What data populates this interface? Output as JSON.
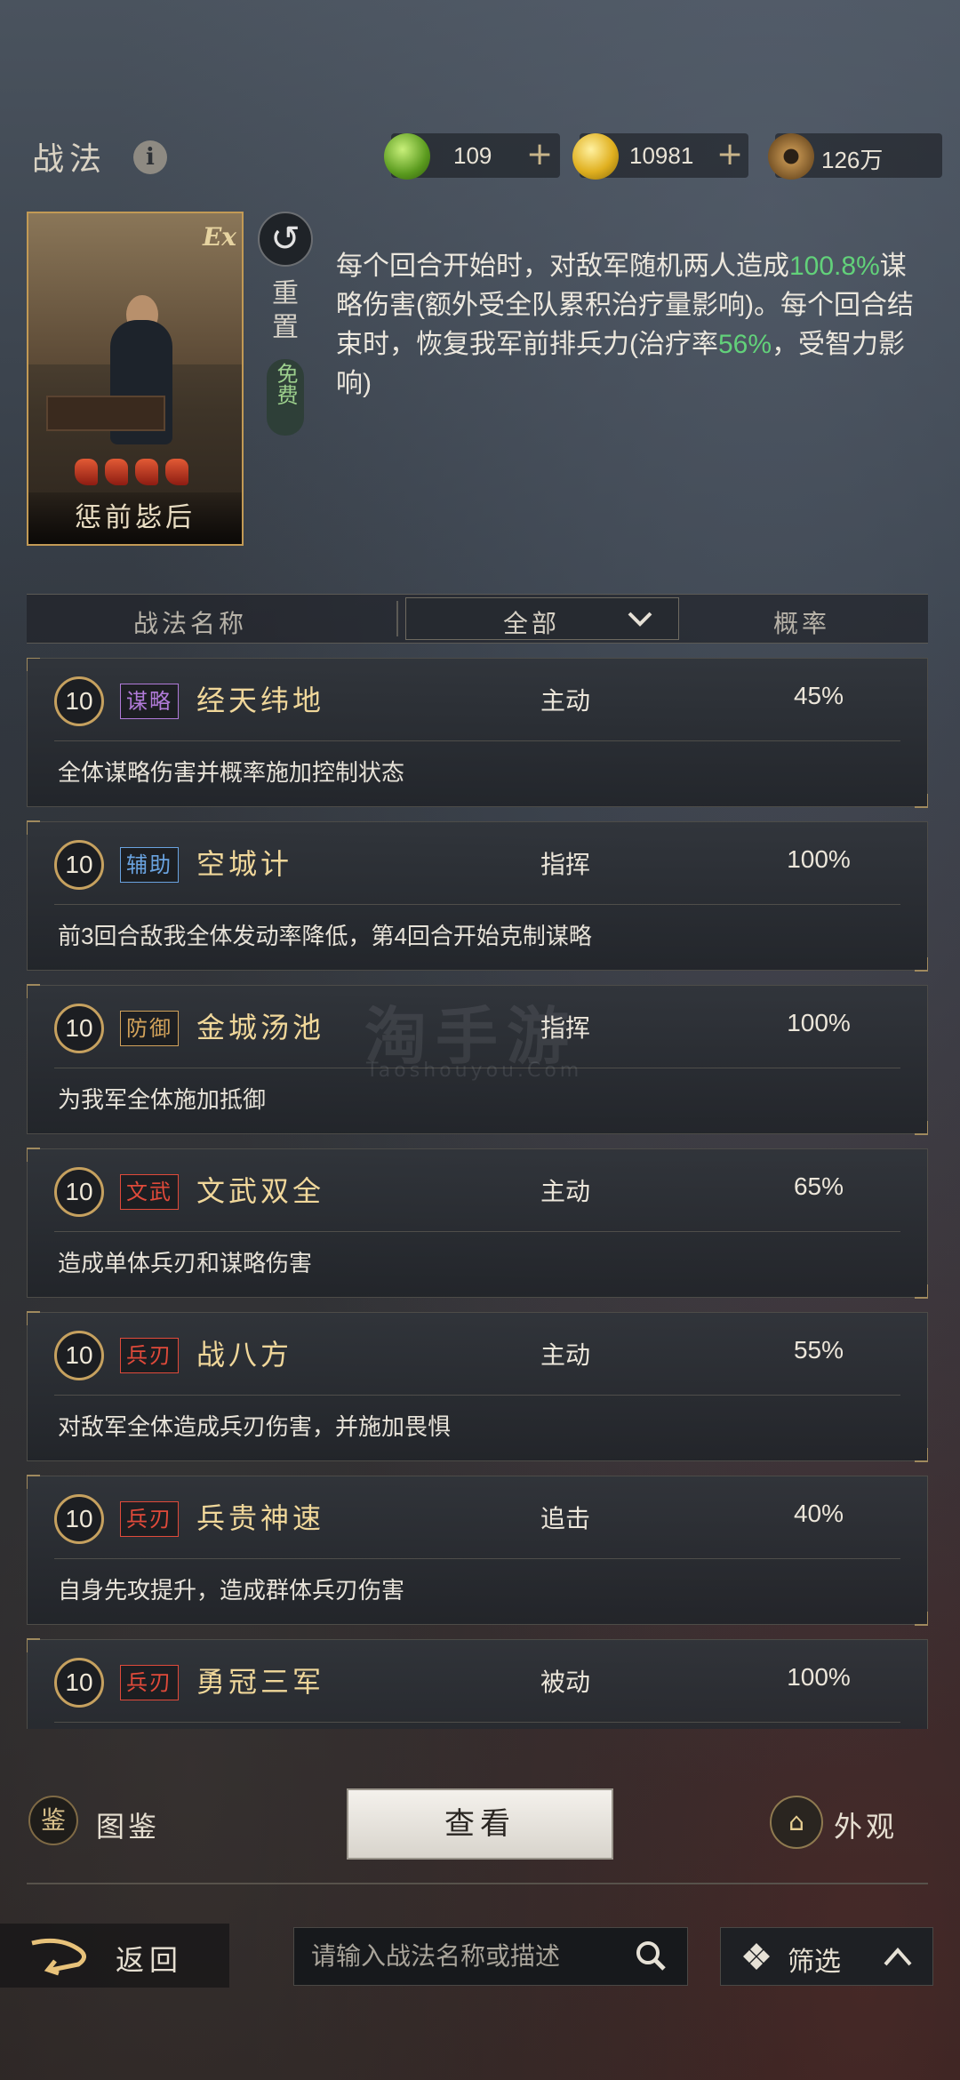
{
  "header": {
    "title": "战法",
    "currencies": [
      {
        "name": "jade",
        "value": "109",
        "color": "#7fbf3a"
      },
      {
        "name": "gold",
        "value": "10981",
        "color": "#e5b620"
      },
      {
        "name": "copper",
        "value": "126万",
        "color": "#a0703a"
      }
    ]
  },
  "hero": {
    "name": "惩前毖后",
    "rank_marks": 4,
    "reset_label": "重置",
    "free_label": "免费"
  },
  "description": {
    "p1": "每个回合开始时，对敌军随机两人造成",
    "v1": "100.8%",
    "p2": "谋略伤害(额外受全队累积治疗量影响)。每个回合结束时，恢复我军前排兵力(治疗率",
    "v2": "56%",
    "p3": "，受智力影响)"
  },
  "table_header": {
    "name_col": "战法名称",
    "filter_value": "全部",
    "rate_col": "概率"
  },
  "skills": [
    {
      "level": "10",
      "tag": "谋略",
      "tag_color": "#b07ad8",
      "name": "经天纬地",
      "type": "主动",
      "rate": "45%",
      "desc": "全体谋略伤害并概率施加控制状态"
    },
    {
      "level": "10",
      "tag": "辅助",
      "tag_color": "#6aa3e0",
      "name": "空城计",
      "type": "指挥",
      "rate": "100%",
      "desc": "前3回合敌我全体发动率降低，第4回合开始克制谋略"
    },
    {
      "level": "10",
      "tag": "防御",
      "tag_color": "#d2a25a",
      "name": "金城汤池",
      "type": "指挥",
      "rate": "100%",
      "desc": "为我军全体施加抵御"
    },
    {
      "level": "10",
      "tag": "文武",
      "tag_color": "#e04a3a",
      "name": "文武双全",
      "type": "主动",
      "rate": "65%",
      "desc": "造成单体兵刃和谋略伤害"
    },
    {
      "level": "10",
      "tag": "兵刃",
      "tag_color": "#e04a3a",
      "name": "战八方",
      "type": "主动",
      "rate": "55%",
      "desc": "对敌军全体造成兵刃伤害，并施加畏惧"
    },
    {
      "level": "10",
      "tag": "兵刃",
      "tag_color": "#e04a3a",
      "name": "兵贵神速",
      "type": "追击",
      "rate": "40%",
      "desc": "自身先攻提升，造成群体兵刃伤害"
    },
    {
      "level": "10",
      "tag": "兵刃",
      "tag_color": "#e04a3a",
      "name": "勇冠三军",
      "type": "被动",
      "rate": "100%",
      "desc": ""
    }
  ],
  "bottom": {
    "codex_icon_char": "鉴",
    "codex_label": "图鉴",
    "view_label": "查看",
    "look_label": "外观"
  },
  "footer": {
    "back_label": "返回",
    "search_placeholder": "请输入战法名称或描述",
    "filter_label": "筛选"
  },
  "watermark": {
    "main": "淘手游",
    "sub": "Taoshouyou.Com"
  }
}
